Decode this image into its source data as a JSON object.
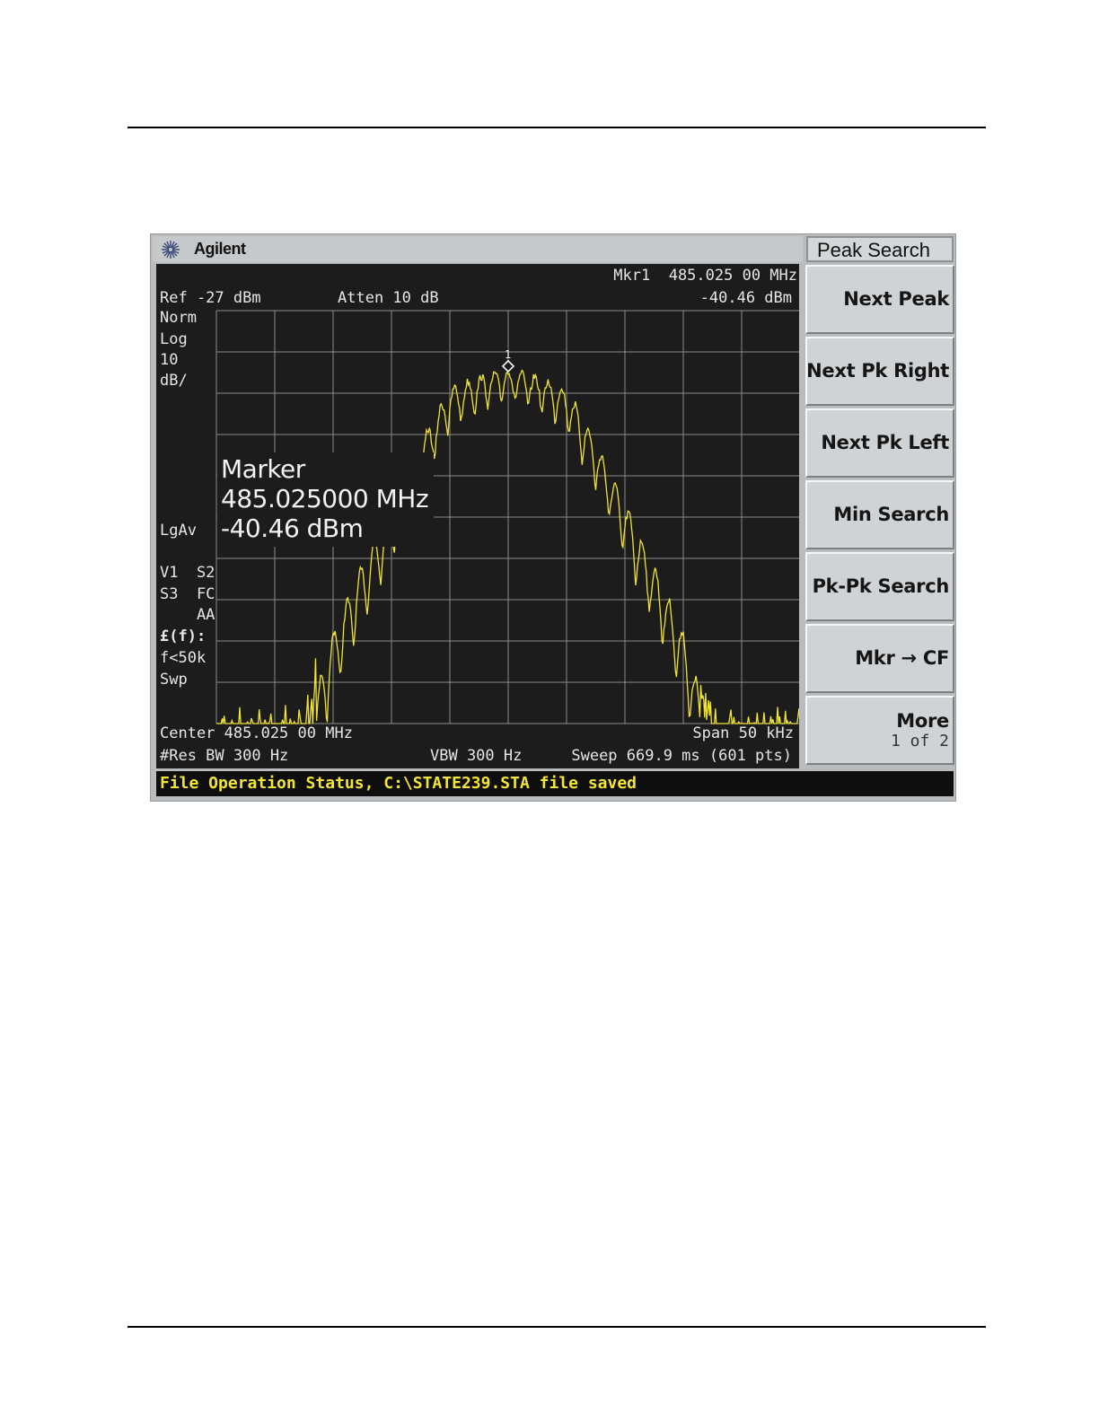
{
  "brand": {
    "name": "Agilent"
  },
  "menu": {
    "title": "Peak Search",
    "softkeys": [
      {
        "label": "Next Peak"
      },
      {
        "label": "Next Pk Right"
      },
      {
        "label": "Next Pk Left"
      },
      {
        "label": "Min Search"
      },
      {
        "label": "Pk-Pk Search"
      },
      {
        "label": "Mkr → CF"
      },
      {
        "label": "More",
        "sub": "1 of 2"
      }
    ]
  },
  "screen": {
    "mkr_readout_freq": "Mkr1  485.025 00 MHz",
    "mkr_readout_amp": "-40.46 dBm",
    "ref_level": "Ref -27 dBm",
    "attenuation": "Atten 10 dB",
    "left_annotations": [
      "Norm",
      "Log",
      "10",
      "dB/"
    ],
    "lgav": "LgAv",
    "left_annotations_2": [
      "V1  S2",
      "S3  FC",
      "    AA",
      "£(f):",
      "f<50k",
      "Swp"
    ],
    "marker_box": {
      "title": "Marker",
      "freq": "485.025000 MHz",
      "amp": "-40.46 dBm"
    },
    "marker_number": "1",
    "center": "Center 485.025 00 MHz",
    "span": "Span 50 kHz",
    "res_bw": "#Res BW 300 Hz",
    "vbw": "VBW 300 Hz",
    "sweep": "Sweep 669.9 ms (601 pts)"
  },
  "status": {
    "text": "File Operation Status, C:\\STATE239.STA file saved"
  },
  "colors": {
    "trace": "#f2e433",
    "screen_bg": "#1c1c1c",
    "grid": "#8a8a8a",
    "status_text": "#f3e535"
  },
  "chart_data": {
    "type": "line",
    "x_center_mhz": 485.025,
    "span_khz": 50,
    "ref_dbm": -27,
    "scale_db_per_div": 10,
    "divisions": 10,
    "marker": {
      "freq_mhz": 485.025,
      "amp_dbm": -40.46
    },
    "trace_envelope_dbm": {
      "noise_floor": -132,
      "x_offset_khz": [
        -25,
        -17.5,
        -15,
        -12.5,
        -10,
        -7.5,
        -5,
        -2.5,
        0,
        2.5,
        5,
        7.5,
        10,
        12.5,
        15,
        17.5,
        25
      ],
      "peak_level": [
        -131,
        -130,
        -104,
        -88,
        -73,
        -58,
        -45,
        -42,
        -40.5,
        -42,
        -45,
        -58,
        -73,
        -88,
        -104,
        -130,
        -131
      ]
    }
  }
}
